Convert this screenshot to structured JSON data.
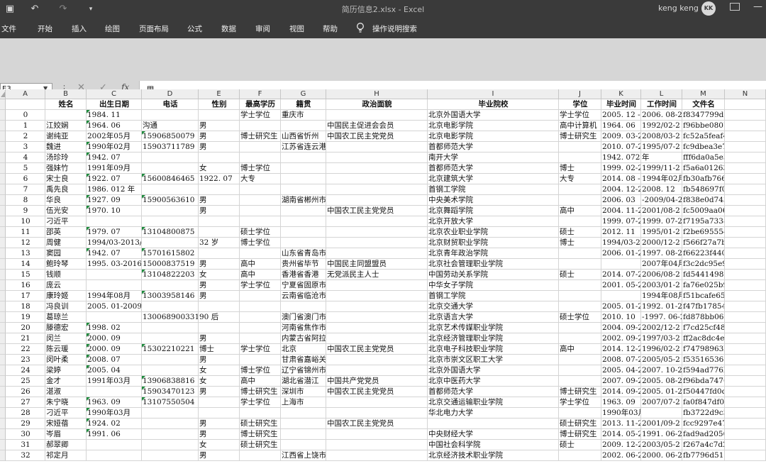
{
  "titlebar": {
    "doc_title": "简历信息2.xlsx  -  Excel",
    "user_name": "keng keng",
    "avatar_initials": "KK",
    "save_icon": "▣",
    "undo_icon": "↶",
    "redo_icon": "↷",
    "customize_icon": "▾",
    "minimize_icon": "—"
  },
  "menu": {
    "tabs": [
      "文件",
      "开始",
      "插入",
      "绘图",
      "页面布局",
      "公式",
      "数据",
      "审阅",
      "视图",
      "帮助"
    ],
    "tell_me": "操作说明搜索"
  },
  "formula_bar": {
    "name_box": "E3",
    "name_box_arrow": "▼",
    "separator": "⋮",
    "cancel_icon": "✕",
    "enter_icon": "✓",
    "fx_label": "fx",
    "content": "男"
  },
  "grid": {
    "columns": [
      "A",
      "B",
      "C",
      "D",
      "E",
      "F",
      "G",
      "H",
      "I",
      "J",
      "K",
      "L",
      "M",
      "N"
    ],
    "rows": [
      {
        "num": "1",
        "hdr": true,
        "cells": [
          "",
          "姓名",
          "出生日期",
          "电话",
          "性别",
          "最高学历",
          "籍贯",
          "政治面貌",
          "毕业院校",
          "学位",
          "毕业时间",
          "工作时间",
          "文件名",
          ""
        ],
        "tri": []
      },
      {
        "num": "2",
        "cells": [
          "0",
          "",
          "1984. 11",
          "",
          "",
          "学士学位",
          "重庆市",
          "",
          "北京外国语大学",
          "学士学位",
          "2005. 12 -2",
          "2006. 08-2",
          "f8347799dc77. pdf",
          ""
        ],
        "tri": [
          2
        ]
      },
      {
        "num": "3",
        "cells": [
          "1",
          "江姣娴",
          "1964. 06",
          "沟通",
          "男",
          "",
          "",
          "中国民主促进会会员",
          "北京电影学院",
          "高中计算机",
          "1964. 06",
          "1992/02-2",
          "f96bbe080756. pdf",
          ""
        ],
        "tri": [
          2
        ]
      },
      {
        "num": "4",
        "cells": [
          "2",
          "谢纯亚",
          "2002年05月",
          "15906850079",
          "男",
          "博士研究生",
          "山西省忻州",
          "中国农工民主党党员",
          "北京电影学院",
          "博士研究生",
          "2009. 03-2",
          "2008/03-2",
          "fc52a5feaf4e. pdf",
          ""
        ],
        "tri": [
          3
        ]
      },
      {
        "num": "5",
        "cells": [
          "3",
          "魏进",
          "1990年02月",
          "15903711789",
          "男",
          "",
          "江苏省连云港市",
          "",
          "首都师范大学",
          "",
          "2010. 07-2",
          "1995/07-2",
          "fc9dbea3e727. pdf",
          ""
        ],
        "tri": [
          2
        ]
      },
      {
        "num": "6",
        "cells": [
          "4",
          "汤珍玲",
          "1942. 07",
          "",
          "",
          "",
          "",
          "",
          "南开大学",
          "",
          "1942. 072",
          "年",
          "fff6da0a5e37. pdf",
          ""
        ],
        "tri": [
          2
        ]
      },
      {
        "num": "7",
        "cells": [
          "5",
          "强妹竹",
          "1991年09月",
          "",
          "女",
          "博士学位",
          "",
          "",
          "首都师范大学",
          "博士",
          "1999.  02-2",
          "1999/11-2",
          "f5a6a01263b2. pdf",
          ""
        ],
        "tri": []
      },
      {
        "num": "8",
        "cells": [
          "6",
          "宋士良",
          "1922. 07",
          "15600846465",
          "1922. 07",
          "大专",
          "",
          "",
          "北京建筑大学",
          "大专",
          "2014. 08 -2",
          "1994年02月",
          "fb30afb766c1. pdf",
          ""
        ],
        "tri": [
          2,
          3
        ]
      },
      {
        "num": "9",
        "cells": [
          "7",
          "禹先良",
          "1986. 012  年",
          "",
          "",
          "",
          "",
          "",
          "首钢工学院",
          "",
          "2004. 12-2",
          "2008. 12",
          "fb548697f000. pdf",
          ""
        ],
        "tri": []
      },
      {
        "num": "10",
        "cells": [
          "8",
          "华良",
          "1927.  09",
          "15900563610",
          "男",
          "",
          "湖南省郴州市",
          "",
          "中央美术学院",
          "",
          "2006. 03",
          "-2009/04-2",
          "f838e0d743d7. pdf",
          ""
        ],
        "tri": [
          2,
          3
        ]
      },
      {
        "num": "11",
        "cells": [
          "9",
          "伍光安",
          "1970. 10",
          "",
          "男",
          "",
          "",
          "中国农工民主党党员",
          "北京舞蹈学院",
          "高中",
          "2004.  11-2",
          "2001/08-2",
          "fc5009aa0611. pdf",
          ""
        ],
        "tri": [
          2
        ]
      },
      {
        "num": "12",
        "cells": [
          "10",
          "刁近平",
          "",
          "",
          "",
          "",
          "",
          "",
          "北京开放大学",
          "",
          "1999. 07-2",
          "1999. 07-2",
          "f7195a7338bc. pdf",
          ""
        ],
        "tri": []
      },
      {
        "num": "13",
        "cells": [
          "11",
          "邵英",
          "1979. 07",
          "13104800875",
          "",
          "硕士学位",
          "",
          "",
          "北京农业职业学院",
          "硕士",
          "2012. 11",
          "1995/01-2",
          "f2be69555427. pdf",
          ""
        ],
        "tri": [
          2,
          3
        ]
      },
      {
        "num": "14",
        "cells": [
          "12",
          "周健",
          "1994/03-2013/11",
          "",
          "32 岁",
          "博士学位",
          "",
          "",
          "北京财贸职业学院",
          "博士",
          "1994/03-2",
          "2000/12-2",
          "f566f27a7b30. pdf",
          ""
        ],
        "tri": []
      },
      {
        "num": "15",
        "cells": [
          "13",
          "窦园",
          "1942. 07",
          "15701615802",
          "",
          "",
          "山东省青岛市",
          "",
          "北京青年政治学院",
          "",
          "2006. 01-2",
          "1997. 08-2",
          "f66223f44059. pdf",
          ""
        ],
        "tri": [
          2,
          3
        ]
      },
      {
        "num": "16",
        "cells": [
          "14",
          "鲍玲琴",
          "1995. 03-2016",
          "15000837519",
          "男",
          "高中",
          "贵州省毕节",
          "中国民主同盟盟员",
          "北京社会管理职业学院",
          "",
          "",
          "2007年04月",
          "f3c2dc95e96b. pdf",
          ""
        ],
        "tri": []
      },
      {
        "num": "17",
        "cells": [
          "15",
          "钱顺",
          "",
          "13104822203",
          "女",
          "高中",
          "香港省香港",
          "无党派民主人士",
          "中国劳动关系学院",
          "硕士",
          "2014. 07-2",
          "2006/08-2",
          "fd5441498d90. pdf",
          ""
        ],
        "tri": [
          3
        ]
      },
      {
        "num": "18",
        "cells": [
          "16",
          "庞云",
          "",
          "",
          "男",
          "学士学位",
          "宁夏省固原市",
          "",
          "中华女子学院",
          "",
          "2001. 05-2",
          "2003/01-2",
          "fa76e025b9d5. pdf",
          ""
        ],
        "tri": []
      },
      {
        "num": "19",
        "cells": [
          "17",
          "康玲姬",
          "1994年08月",
          "13003958146",
          "男",
          "",
          "云南省临沧市",
          "",
          "首钢工学院",
          "",
          "",
          "1994年08月",
          "f51bcafe658d. pdf",
          ""
        ],
        "tri": [
          3
        ]
      },
      {
        "num": "20",
        "cells": [
          "18",
          "冯良训",
          "2005. 01-2009. 01",
          "",
          "",
          "",
          "",
          "",
          "北京交通大学",
          "",
          "2005. 01-2",
          "1992. 01-2",
          "f47fb178544d. pdf",
          ""
        ],
        "tri": []
      },
      {
        "num": "21",
        "cells": [
          "19",
          "葛琼兰",
          "",
          "130068900331",
          "90 后",
          "",
          "澳门省澳门市",
          "",
          "北京语言大学",
          "硕士学位",
          "2010. 10",
          "-1997. 06-2",
          "fd878bb0611a. pdf",
          ""
        ],
        "tri": []
      },
      {
        "num": "22",
        "cells": [
          "20",
          "滕德宏",
          "1998. 02",
          "",
          "",
          "",
          "河南省焦作市",
          "",
          "北京艺术传媒职业学院",
          "",
          "2004. 09-2",
          "2002/12-2",
          "f7cd25cf48b6. pdf",
          ""
        ],
        "tri": [
          2
        ]
      },
      {
        "num": "23",
        "cells": [
          "21",
          "闵兰",
          "2000. 09",
          "",
          "男",
          "",
          "内蒙古省阿拉善盟",
          "",
          "北京经济管理职业学院",
          "",
          "2002. 09-2",
          "1997/03-2",
          "ff2ac8dc4ef8. pdf",
          ""
        ],
        "tri": [
          2
        ]
      },
      {
        "num": "24",
        "cells": [
          "22",
          "陈云瑗",
          "2000. 09",
          "15302210221",
          "博士",
          "学士学位",
          "北京",
          "中国农工民主党党员",
          "北京电子科技职业学院",
          "高中",
          "2014. 12-2",
          "1996/02-2",
          "f74798963bbe. pdf",
          ""
        ],
        "tri": [
          2,
          3
        ]
      },
      {
        "num": "25",
        "cells": [
          "23",
          "闵叶柔",
          "2008. 07",
          "",
          "男",
          "",
          "甘肃省嘉峪关市",
          "",
          "北京市崇文区职工大学",
          "",
          "2008. 07-2",
          "2005/05-2",
          "f5351653600a. pdf",
          ""
        ],
        "tri": [
          2
        ]
      },
      {
        "num": "26",
        "cells": [
          "24",
          "梁婷",
          "2005. 04",
          "",
          "女",
          "博士学位",
          "辽宁省锦州市",
          "",
          "北京外国语大学",
          "",
          "2005. 04-2",
          "2007. 10-2",
          "f594ad776b59. pdf",
          ""
        ],
        "tri": [
          2
        ]
      },
      {
        "num": "27",
        "cells": [
          "25",
          "金才",
          "1991年03月",
          "13906838816",
          "女",
          "高中",
          "湖北省潜江",
          "中国共产党党员",
          "北京中医药大学",
          "",
          "2007. 09-2",
          "2005. 08-2",
          "f96bda7476d2. pdf",
          ""
        ],
        "tri": [
          3
        ]
      },
      {
        "num": "28",
        "cells": [
          "26",
          "湛淑",
          "",
          "15903470123",
          "男",
          "博士研究生",
          "深圳市",
          "中国农工民主党党员",
          "首都师范大学",
          "博士研究生",
          "2014. 09-2",
          "2005. 01-2",
          "f50447fd0d48. pdf",
          ""
        ],
        "tri": [
          3
        ]
      },
      {
        "num": "29",
        "cells": [
          "27",
          "朱宁晓",
          "1963. 09",
          "13107550504",
          "",
          "学士学位",
          "上海市",
          "",
          "北京交通运输职业学院",
          "学士学位",
          "1963. 09",
          "2007/07-2",
          "fa0f847df067. pdf",
          ""
        ],
        "tri": [
          2,
          3
        ]
      },
      {
        "num": "30",
        "cells": [
          "28",
          "刁近平",
          "1990年03月",
          "",
          "",
          "",
          "",
          "",
          "华北电力大学",
          "",
          "1990年03月",
          "",
          "fb3722d9c5df. pdf",
          ""
        ],
        "tri": [
          2
        ]
      },
      {
        "num": "31",
        "cells": [
          "29",
          "宋娅蓓",
          "1924. 02",
          "",
          "男",
          "硕士研究生",
          "",
          "中国农工民主党党员",
          "",
          "硕士研究生",
          "2013. 11-2",
          "2001/09-2",
          "fcc9297e479f. pdf",
          ""
        ],
        "tri": [
          2
        ]
      },
      {
        "num": "32",
        "cells": [
          "30",
          "岑眉",
          "1991. 06",
          "",
          "男",
          "博士研究生",
          "",
          "",
          "中央财经大学",
          "博士研究生",
          "2014. 05-2",
          "1991. 06-2",
          "fad9ad2050bb. pdf",
          ""
        ],
        "tri": [
          2
        ]
      },
      {
        "num": "33",
        "cells": [
          "31",
          "郝翠卿",
          "",
          "",
          "女",
          "硕士研究生",
          "",
          "",
          "中国社会科学院",
          "硕士",
          "2009. 12-2",
          "2003/05-2",
          "f267a4c7d2b8. pdf",
          ""
        ],
        "tri": []
      },
      {
        "num": "34",
        "cells": [
          "32",
          "祁定月",
          "",
          "",
          "男",
          "",
          "江西省上饶市",
          "",
          "北京经济技术职业学院",
          "",
          "2002. 06-2",
          "2000. 06-2",
          "fb7796d512bb. pdf",
          ""
        ],
        "tri": []
      }
    ]
  }
}
